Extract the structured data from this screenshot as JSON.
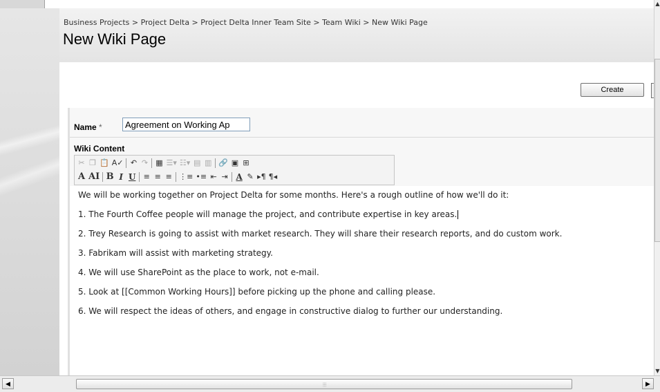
{
  "breadcrumb": "Business Projects > Project Delta > Project Delta Inner Team Site > Team Wiki > New Wiki Page",
  "page_title": "New Wiki Page",
  "create_button": "Create",
  "form": {
    "name_label": "Name",
    "required_marker": "*",
    "name_value": "Agreement on Working Ap",
    "wiki_label": "Wiki Content"
  },
  "toolbar": {
    "row1": [
      "cut-icon",
      "copy-icon",
      "paste-icon",
      "spellcheck-icon",
      "undo-icon",
      "redo-icon",
      "table-icon",
      "insert-row-icon",
      "insert-column-icon",
      "merge-cells-icon",
      "split-cells-icon",
      "hyperlink-icon",
      "image-icon",
      "source-icon"
    ],
    "row2": [
      "font-icon",
      "font-size-icon",
      "bold-icon",
      "italic-icon",
      "underline-icon",
      "align-left-icon",
      "align-center-icon",
      "align-right-icon",
      "numbered-list-icon",
      "bullet-list-icon",
      "decrease-indent-icon",
      "increase-indent-icon",
      "text-color-icon",
      "highlight-icon",
      "ltr-icon",
      "rtl-icon"
    ]
  },
  "content": [
    "We will be working together on Project Delta for some months. Here's a rough outline of how we'll do it:",
    "1. The Fourth Coffee people will manage the project, and contribute expertise in key areas.",
    "2. Trey Research is going to assist with market research. They will share their research reports, and do custom work.",
    "3. Fabrikam will assist with marketing strategy.",
    "4. We will use SharePoint as the place to work, not e-mail.",
    "5. Look at [[Common Working Hours]] before picking up the phone and calling please.",
    "6. We will respect the ideas of others, and engage in constructive dialog to further our understanding."
  ]
}
